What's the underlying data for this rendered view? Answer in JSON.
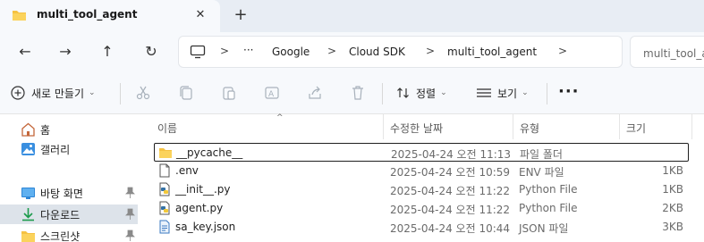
{
  "tab": {
    "title": "multi_tool_agent",
    "close_glyph": "✕",
    "new_glyph": "+"
  },
  "nav": {
    "back_glyph": "←",
    "forward_glyph": "→",
    "up_glyph": "↑",
    "refresh_glyph": "↻"
  },
  "address": {
    "ellipsis": "···",
    "breadcrumbs": [
      "Google",
      "Cloud SDK",
      "multi_tool_agent"
    ],
    "separator": ">"
  },
  "search": {
    "placeholder": "multi_tool_agent 검색"
  },
  "commands": {
    "new_label": "새로 만들기",
    "sort_label": "정렬",
    "view_label": "보기",
    "more_glyph": "···"
  },
  "sidebar": {
    "items": [
      {
        "label": "홈",
        "icon": "home-icon"
      },
      {
        "label": "갤러리",
        "icon": "gallery-icon"
      },
      {
        "label": "바탕 화면",
        "icon": "desktop-icon",
        "pinned": true
      },
      {
        "label": "다운로드",
        "icon": "download-icon",
        "pinned": true,
        "selected": true
      },
      {
        "label": "스크린샷",
        "icon": "folder-icon",
        "pinned": true
      }
    ]
  },
  "columns": {
    "name": "이름",
    "date": "수정한 날짜",
    "type": "유형",
    "size": "크기"
  },
  "files": [
    {
      "name": "__pycache__",
      "date": "2025-04-24 오전 11:13",
      "type": "파일 폴더",
      "size": "",
      "icon": "folder-icon"
    },
    {
      "name": ".env",
      "date": "2025-04-24 오전 10:59",
      "type": "ENV 파일",
      "size": "1KB",
      "icon": "file-icon"
    },
    {
      "name": "__init__.py",
      "date": "2025-04-24 오전 11:22",
      "type": "Python File",
      "size": "1KB",
      "icon": "python-file-icon"
    },
    {
      "name": "agent.py",
      "date": "2025-04-24 오전 11:22",
      "type": "Python File",
      "size": "2KB",
      "icon": "python-file-icon"
    },
    {
      "name": "sa_key.json",
      "date": "2025-04-24 오전 10:44",
      "type": "JSON 파일",
      "size": "3KB",
      "icon": "json-file-icon"
    }
  ],
  "colors": {
    "folder": "#f5c242",
    "accent": "#0067c0",
    "selected_bg": "#dde3ea"
  }
}
